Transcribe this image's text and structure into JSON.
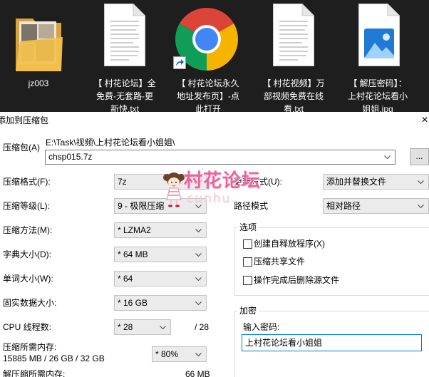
{
  "desktop": {
    "files": [
      {
        "icon": "folder-icon",
        "label_lines": [
          "jz003"
        ]
      },
      {
        "icon": "text-file-icon",
        "label_lines": [
          "【 村花论坛】全",
          "免费-无套路-更",
          "新快.txt"
        ]
      },
      {
        "icon": "chrome-icon",
        "overlay_icon": "shortcut-arrow-icon",
        "label_lines": [
          "【 村花论坛永久",
          "地址发布页】-点",
          "此打开"
        ]
      },
      {
        "icon": "text-file-icon",
        "label_lines": [
          "【 村花视频】万",
          "部视频免费在线",
          "看.txt"
        ]
      },
      {
        "icon": "image-file-icon",
        "label_lines": [
          "【 解压密码】：",
          "上村花论坛看小",
          "姐姐.jpg"
        ]
      }
    ]
  },
  "dialog": {
    "title": "添加到压缩包",
    "close_glyph": "×",
    "archive": {
      "label": "压缩包(A)",
      "path": "E:\\Task\\视频\\上村花论坛看小姐姐\\",
      "filename": "chsp015.7z",
      "browse_label": "..."
    },
    "left": {
      "format": {
        "label": "压缩格式(F):",
        "value": "7z"
      },
      "level": {
        "label": "压缩等级(L):",
        "value": "9 - 极限压缩"
      },
      "method": {
        "label": "压缩方法(M):",
        "value": "* LZMA2"
      },
      "dictionary": {
        "label": "字典大小(D):",
        "value": "* 64 MB"
      },
      "word": {
        "label": "单词大小(W):",
        "value": "* 64"
      },
      "solid": {
        "label": "固实数据大小:",
        "value": "* 16 GB"
      },
      "threads": {
        "label": "CPU 线程数:",
        "value": "* 28",
        "max": "/ 28"
      },
      "memory_compress": {
        "label": "压缩所需内存:",
        "detail": "15885 MB / 26 GB / 32 GB",
        "value": "* 80%"
      },
      "memory_decompress": {
        "label": "解压缩所需内存:",
        "value": "66 MB"
      }
    },
    "right": {
      "update": {
        "label": "更新方式(U):",
        "value": "添加并替换文件"
      },
      "path_mode": {
        "label": "路径模式",
        "value": "相对路径"
      },
      "options": {
        "title": "选项",
        "checkboxes": [
          {
            "label": "创建自释放程序(X)",
            "checked": false
          },
          {
            "label": "压缩共享文件",
            "checked": false
          },
          {
            "label": "操作完成后删除源文件",
            "checked": false
          }
        ]
      },
      "encryption": {
        "title": "加密",
        "password_label": "输入密码:",
        "password_value": "上村花论坛看小姐姐"
      }
    }
  },
  "watermark": {
    "title": "村花论坛",
    "subtitle": "cunhu"
  },
  "colors": {
    "desktop_bg": "#1e1e1e",
    "dialog_bg": "#ffffff",
    "focus_border": "#0078d7",
    "watermark_pink": "#f0609b"
  }
}
